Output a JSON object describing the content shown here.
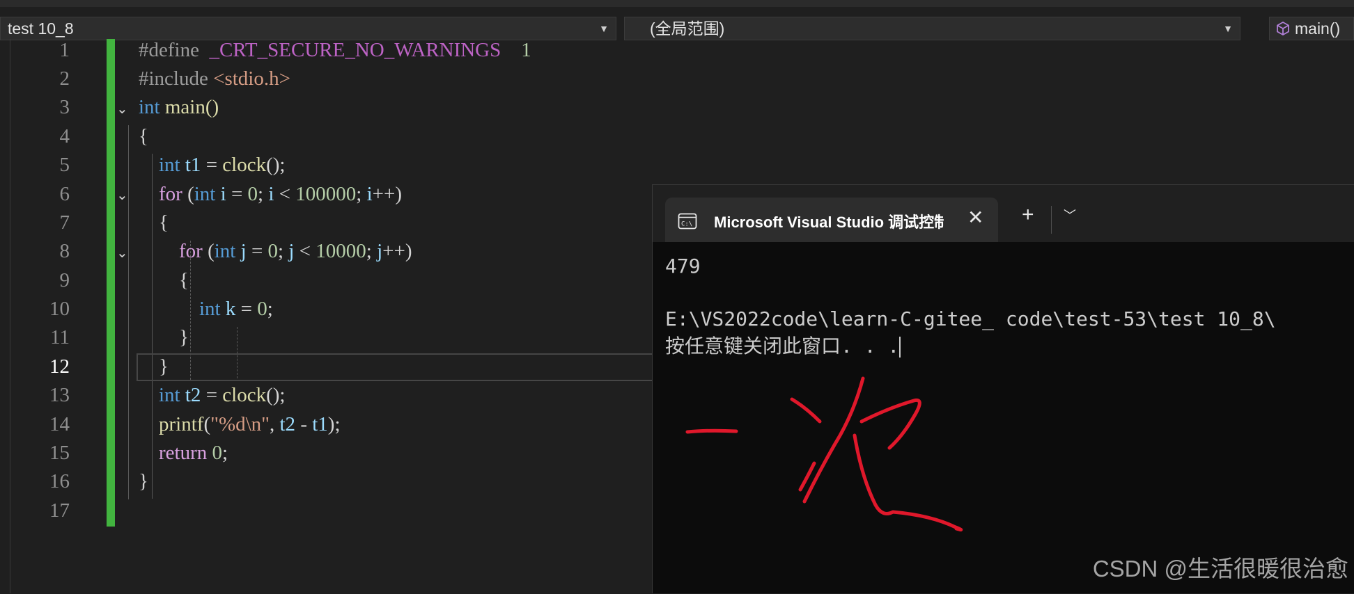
{
  "nav": {
    "project": "test 10_8",
    "scope": "(全局范围)",
    "member": "main()"
  },
  "editor": {
    "active_line": 12,
    "line_numbers": [
      "1",
      "2",
      "3",
      "4",
      "5",
      "6",
      "7",
      "8",
      "9",
      "10",
      "11",
      "12",
      "13",
      "14",
      "15",
      "16",
      "17"
    ],
    "lines": {
      "l1": {
        "directive": "#define",
        "macro": "_CRT_SECURE_NO_WARNINGS",
        "value": "1"
      },
      "l2": {
        "directive": "#include",
        "header": "<stdio.h>"
      },
      "l3": {
        "type": "int",
        "name": "main()"
      },
      "l4": {
        "brace": "{"
      },
      "l5": {
        "type": "int",
        "var": "t1",
        "assign": " = ",
        "call": "clock",
        "rest": "();"
      },
      "l6": {
        "kw": "for",
        "open": " (",
        "type": "int",
        "var": "i",
        "eq": " = ",
        "init": "0",
        "sep1": "; ",
        "var2": "i",
        "lt": " < ",
        "limit": "100000",
        "sep2": "; ",
        "var3": "i",
        "close": "++)"
      },
      "l7": {
        "brace": "{"
      },
      "l8": {
        "kw": "for",
        "open": " (",
        "type": "int",
        "var": "j",
        "eq": " = ",
        "init": "0",
        "sep1": "; ",
        "var2": "j",
        "lt": " < ",
        "limit": "10000",
        "sep2": "; ",
        "var3": "j",
        "close": "++)"
      },
      "l9": {
        "brace": "{"
      },
      "l10": {
        "type": "int",
        "var": "k",
        "eq": " = ",
        "value": "0",
        "end": ";"
      },
      "l11": {
        "brace": "}"
      },
      "l12": {
        "brace": "}"
      },
      "l13": {
        "type": "int",
        "var": "t2",
        "assign": " = ",
        "call": "clock",
        "rest": "();"
      },
      "l14": {
        "call": "printf",
        "open": "(",
        "fmt": "\"%d\\n\"",
        "comma": ", ",
        "var1": "t2",
        "minus": " - ",
        "var2": "t1",
        "close": ");"
      },
      "l15": {
        "kw": "return",
        "value": "0",
        "end": ";"
      },
      "l16": {
        "brace": "}"
      }
    }
  },
  "console": {
    "tab_title": "Microsoft Visual Studio 调试控制台",
    "output": "479",
    "path_line": "E:\\VS2022code\\learn-C-gitee_ code\\test-53\\test 10_8\\",
    "prompt": "按任意键关闭此窗口. . .",
    "handwriting": "一次"
  },
  "watermark": "CSDN @生活很暖很治愈",
  "colors": {
    "keyword": "#569cd6",
    "control": "#d8a0df",
    "identifier": "#9cdcfe",
    "function": "#dcdcaa",
    "number": "#b5cea8",
    "string": "#d69d85",
    "change_bar": "#42b43f",
    "handwriting": "#e0182b"
  },
  "icons": [
    "chevron-down-icon",
    "cube-icon",
    "fold-chevron-icon",
    "terminal-icon",
    "close-icon",
    "plus-icon"
  ]
}
